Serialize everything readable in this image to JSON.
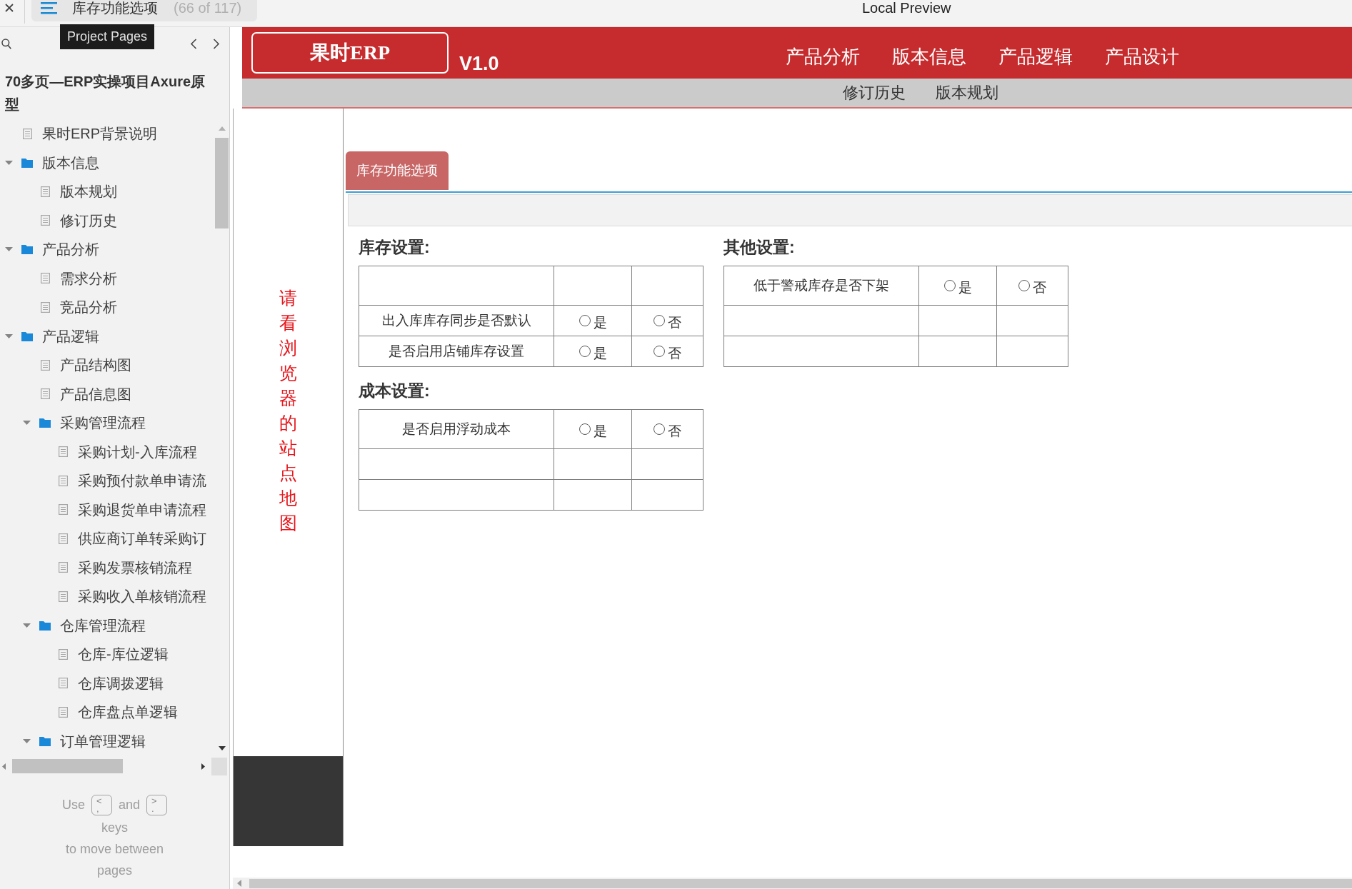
{
  "top_bar": {
    "page_title": "库存功能选项",
    "page_count": "(66 of 117)",
    "window_title": "Local Preview"
  },
  "tooltip": "Project Pages",
  "sidebar": {
    "project_title": "70多页—ERP实操项目Axure原型",
    "tree": [
      {
        "label": "果时ERP背景说明",
        "kind": "page",
        "selected": false
      },
      {
        "label": "版本信息",
        "kind": "folder",
        "expanded": true,
        "selected": false,
        "children": [
          {
            "label": "版本规划",
            "kind": "page",
            "selected": false
          },
          {
            "label": "修订历史",
            "kind": "page",
            "selected": false
          }
        ]
      },
      {
        "label": "产品分析",
        "kind": "folder",
        "expanded": true,
        "selected": false,
        "children": [
          {
            "label": "需求分析",
            "kind": "page",
            "selected": false
          },
          {
            "label": "竞品分析",
            "kind": "page",
            "selected": false
          }
        ]
      },
      {
        "label": "产品逻辑",
        "kind": "folder",
        "expanded": true,
        "selected": false,
        "children": [
          {
            "label": "产品结构图",
            "kind": "page",
            "selected": false
          },
          {
            "label": "产品信息图",
            "kind": "page",
            "selected": false
          },
          {
            "label": "采购管理流程",
            "kind": "folder",
            "expanded": true,
            "selected": false,
            "children": [
              {
                "label": "采购计划-入库流程",
                "kind": "page",
                "selected": false
              },
              {
                "label": "采购预付款单申请流",
                "kind": "page",
                "selected": false
              },
              {
                "label": "采购退货单申请流程",
                "kind": "page",
                "selected": false
              },
              {
                "label": "供应商订单转采购订",
                "kind": "page",
                "selected": false
              },
              {
                "label": "采购发票核销流程",
                "kind": "page",
                "selected": false
              },
              {
                "label": "采购收入单核销流程",
                "kind": "page",
                "selected": false
              }
            ]
          },
          {
            "label": "仓库管理流程",
            "kind": "folder",
            "expanded": true,
            "selected": false,
            "children": [
              {
                "label": "仓库-库位逻辑",
                "kind": "page",
                "selected": false
              },
              {
                "label": "仓库调拨逻辑",
                "kind": "page",
                "selected": false
              },
              {
                "label": "仓库盘点单逻辑",
                "kind": "page",
                "selected": false
              }
            ]
          },
          {
            "label": "订单管理逻辑",
            "kind": "folder",
            "expanded": true,
            "selected": false
          }
        ]
      }
    ],
    "key_hint": {
      "lead": "Use",
      "keys": [
        {
          "top": "<",
          "bottom": ","
        },
        {
          "top": ">",
          "bottom": "."
        }
      ],
      "joiner": "and",
      "lines": [
        "keys",
        "to move between",
        "pages"
      ]
    }
  },
  "header": {
    "logo": "果时ERP",
    "version": "V1.0",
    "nav": [
      "产品分析",
      "版本信息",
      "产品逻辑",
      "产品设计"
    ],
    "subnav": [
      "修订历史",
      "版本规划"
    ]
  },
  "sitemap_note": "请看浏览器的站点地图",
  "tabs": [
    {
      "label": "库存功能选项",
      "selected": true
    }
  ],
  "settings_columns": [
    {
      "sections": [
        {
          "title": "库存设置:",
          "rows": [
            {
              "kind": "blank"
            },
            {
              "kind": "option",
              "label": "出入库库存同步是否默认",
              "choices": [
                {
                  "label": "是",
                  "selected": false
                },
                {
                  "label": "否",
                  "selected": false
                }
              ]
            },
            {
              "kind": "option",
              "label": "是否启用店铺库存设置",
              "choices": [
                {
                  "label": "是",
                  "selected": false
                },
                {
                  "label": "否",
                  "selected": false
                }
              ]
            }
          ]
        },
        {
          "title": "成本设置:",
          "rows": [
            {
              "kind": "option",
              "label": "是否启用浮动成本",
              "choices": [
                {
                  "label": "是",
                  "selected": false
                },
                {
                  "label": "否",
                  "selected": false
                }
              ]
            },
            {
              "kind": "blank"
            },
            {
              "kind": "blank"
            }
          ]
        }
      ]
    },
    {
      "sections": [
        {
          "title": "其他设置:",
          "rows": [
            {
              "kind": "option",
              "label": "低于警戒库存是否下架",
              "choices": [
                {
                  "label": "是",
                  "selected": false
                },
                {
                  "label": "否",
                  "selected": false
                }
              ]
            },
            {
              "kind": "blank"
            },
            {
              "kind": "blank"
            }
          ]
        }
      ]
    }
  ]
}
